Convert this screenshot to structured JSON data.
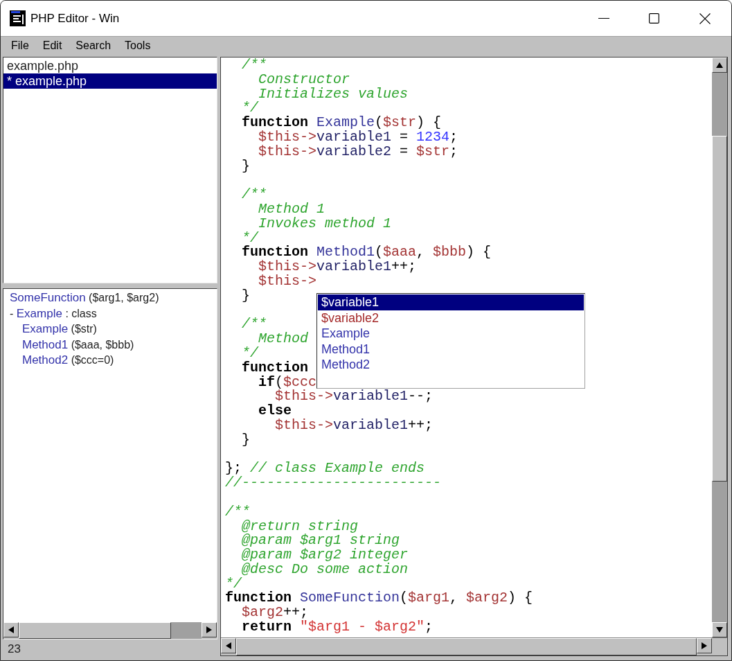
{
  "window": {
    "title": "PHP Editor - Win"
  },
  "menu": [
    "File",
    "Edit",
    "Search",
    "Tools"
  ],
  "files": [
    {
      "name": "example.php",
      "selected": false
    },
    {
      "name": "* example.php",
      "selected": true
    }
  ],
  "outline": [
    {
      "name": "SomeFunction",
      "detail": "($arg1, $arg2)"
    },
    {
      "toggle": "-",
      "name": "Example",
      "detail": ": class",
      "children": [
        {
          "name": "Example",
          "detail": "($str)"
        },
        {
          "name": "Method1",
          "detail": "($aaa, $bbb)"
        },
        {
          "name": "Method2",
          "detail": "($ccc=0)"
        }
      ]
    }
  ],
  "status_bar": {
    "text": "23"
  },
  "editor": {
    "lines": [
      {
        "kind": "code",
        "segments": [
          {
            "kind": "comment",
            "text": "  /**"
          }
        ]
      },
      {
        "kind": "code",
        "segments": [
          {
            "kind": "comment",
            "text": "    Constructor"
          }
        ]
      },
      {
        "kind": "code",
        "segments": [
          {
            "kind": "comment",
            "text": "    Initializes values"
          }
        ]
      },
      {
        "kind": "code",
        "segments": [
          {
            "kind": "comment",
            "text": "  */"
          }
        ]
      },
      {
        "kind": "code",
        "segments": [
          {
            "kind": "keyword",
            "text": "  function"
          },
          {
            "kind": "function",
            "text": " Example"
          },
          {
            "kind": "plain",
            "text": "("
          },
          {
            "kind": "variable",
            "text": "$str"
          },
          {
            "kind": "plain",
            "text": ") {"
          }
        ]
      },
      {
        "kind": "code",
        "segments": [
          {
            "kind": "variable",
            "text": "    $this->"
          },
          {
            "kind": "property",
            "text": "variable1"
          },
          {
            "kind": "plain",
            "text": " = "
          },
          {
            "kind": "number",
            "text": "1234"
          },
          {
            "kind": "plain",
            "text": ";"
          }
        ]
      },
      {
        "kind": "code",
        "segments": [
          {
            "kind": "variable",
            "text": "    $this->"
          },
          {
            "kind": "property",
            "text": "variable2"
          },
          {
            "kind": "plain",
            "text": " = "
          },
          {
            "kind": "variable",
            "text": "$str"
          },
          {
            "kind": "plain",
            "text": ";"
          }
        ]
      },
      {
        "kind": "code",
        "segments": [
          {
            "kind": "plain",
            "text": "  }"
          }
        ]
      },
      {
        "kind": "blank"
      },
      {
        "kind": "code",
        "segments": [
          {
            "kind": "comment",
            "text": "  /**"
          }
        ]
      },
      {
        "kind": "code",
        "segments": [
          {
            "kind": "comment",
            "text": "    Method 1"
          }
        ]
      },
      {
        "kind": "code",
        "segments": [
          {
            "kind": "comment",
            "text": "    Invokes method 1"
          }
        ]
      },
      {
        "kind": "code",
        "segments": [
          {
            "kind": "comment",
            "text": "  */"
          }
        ]
      },
      {
        "kind": "code",
        "segments": [
          {
            "kind": "keyword",
            "text": "  function"
          },
          {
            "kind": "function",
            "text": " Method1"
          },
          {
            "kind": "plain",
            "text": "("
          },
          {
            "kind": "variable",
            "text": "$aaa"
          },
          {
            "kind": "plain",
            "text": ", "
          },
          {
            "kind": "variable",
            "text": "$bbb"
          },
          {
            "kind": "plain",
            "text": ") {"
          }
        ]
      },
      {
        "kind": "code",
        "segments": [
          {
            "kind": "variable",
            "text": "    $this->"
          },
          {
            "kind": "property",
            "text": "variable1"
          },
          {
            "kind": "plain",
            "text": "++;"
          }
        ]
      },
      {
        "kind": "code",
        "segments": [
          {
            "kind": "variable",
            "text": "    $this->"
          }
        ]
      },
      {
        "kind": "code",
        "segments": [
          {
            "kind": "plain",
            "text": "  }"
          }
        ]
      },
      {
        "kind": "blank"
      },
      {
        "kind": "code",
        "segments": [
          {
            "kind": "comment",
            "text": "  /**"
          }
        ]
      },
      {
        "kind": "code",
        "segments": [
          {
            "kind": "comment",
            "text": "    Method"
          }
        ]
      },
      {
        "kind": "code",
        "segments": [
          {
            "kind": "comment",
            "text": "  */"
          }
        ]
      },
      {
        "kind": "code",
        "segments": [
          {
            "kind": "keyword",
            "text": "  function"
          }
        ]
      },
      {
        "kind": "code",
        "segments": [
          {
            "kind": "keyword",
            "text": "    if"
          },
          {
            "kind": "plain",
            "text": "("
          },
          {
            "kind": "variable",
            "text": "$ccc"
          }
        ]
      },
      {
        "kind": "code",
        "segments": [
          {
            "kind": "variable",
            "text": "      $this->"
          },
          {
            "kind": "property",
            "text": "variable1"
          },
          {
            "kind": "plain",
            "text": "--;"
          }
        ]
      },
      {
        "kind": "code",
        "segments": [
          {
            "kind": "keyword",
            "text": "    else"
          }
        ]
      },
      {
        "kind": "code",
        "segments": [
          {
            "kind": "variable",
            "text": "      $this->"
          },
          {
            "kind": "property",
            "text": "variable1"
          },
          {
            "kind": "plain",
            "text": "++;"
          }
        ]
      },
      {
        "kind": "code",
        "segments": [
          {
            "kind": "plain",
            "text": "  }"
          }
        ]
      },
      {
        "kind": "blank"
      },
      {
        "kind": "code",
        "segments": [
          {
            "kind": "plain",
            "text": "}; "
          },
          {
            "kind": "comment",
            "text": "// class Example ends"
          }
        ]
      },
      {
        "kind": "code",
        "segments": [
          {
            "kind": "comment",
            "text": "//------------------------"
          }
        ]
      },
      {
        "kind": "blank"
      },
      {
        "kind": "code",
        "segments": [
          {
            "kind": "comment",
            "text": "/**"
          }
        ]
      },
      {
        "kind": "code",
        "segments": [
          {
            "kind": "comment",
            "text": "  @return string"
          }
        ]
      },
      {
        "kind": "code",
        "segments": [
          {
            "kind": "comment",
            "text": "  @param $arg1 string"
          }
        ]
      },
      {
        "kind": "code",
        "segments": [
          {
            "kind": "comment",
            "text": "  @param $arg2 integer"
          }
        ]
      },
      {
        "kind": "code",
        "segments": [
          {
            "kind": "comment",
            "text": "  @desc Do some action"
          }
        ]
      },
      {
        "kind": "code",
        "segments": [
          {
            "kind": "comment",
            "text": "*/"
          }
        ]
      },
      {
        "kind": "code",
        "segments": [
          {
            "kind": "keyword",
            "text": "function"
          },
          {
            "kind": "function",
            "text": " SomeFunction"
          },
          {
            "kind": "plain",
            "text": "("
          },
          {
            "kind": "variable",
            "text": "$arg1"
          },
          {
            "kind": "plain",
            "text": ", "
          },
          {
            "kind": "variable",
            "text": "$arg2"
          },
          {
            "kind": "plain",
            "text": ") {"
          }
        ]
      },
      {
        "kind": "code",
        "segments": [
          {
            "kind": "variable",
            "text": "  $arg2"
          },
          {
            "kind": "plain",
            "text": "++;"
          }
        ]
      },
      {
        "kind": "code",
        "segments": [
          {
            "kind": "keyword",
            "text": "  return"
          },
          {
            "kind": "string",
            "text": " \"$arg1 - $arg2\""
          },
          {
            "kind": "plain",
            "text": ";"
          }
        ]
      }
    ],
    "completion": {
      "items": [
        {
          "kind": "variable",
          "label": "$variable1",
          "selected": true
        },
        {
          "kind": "variable",
          "label": "$variable2",
          "selected": false
        },
        {
          "kind": "method",
          "label": "Example",
          "selected": false
        },
        {
          "kind": "method",
          "label": "Method1",
          "selected": false
        },
        {
          "kind": "method",
          "label": "Method2",
          "selected": false
        }
      ]
    }
  }
}
